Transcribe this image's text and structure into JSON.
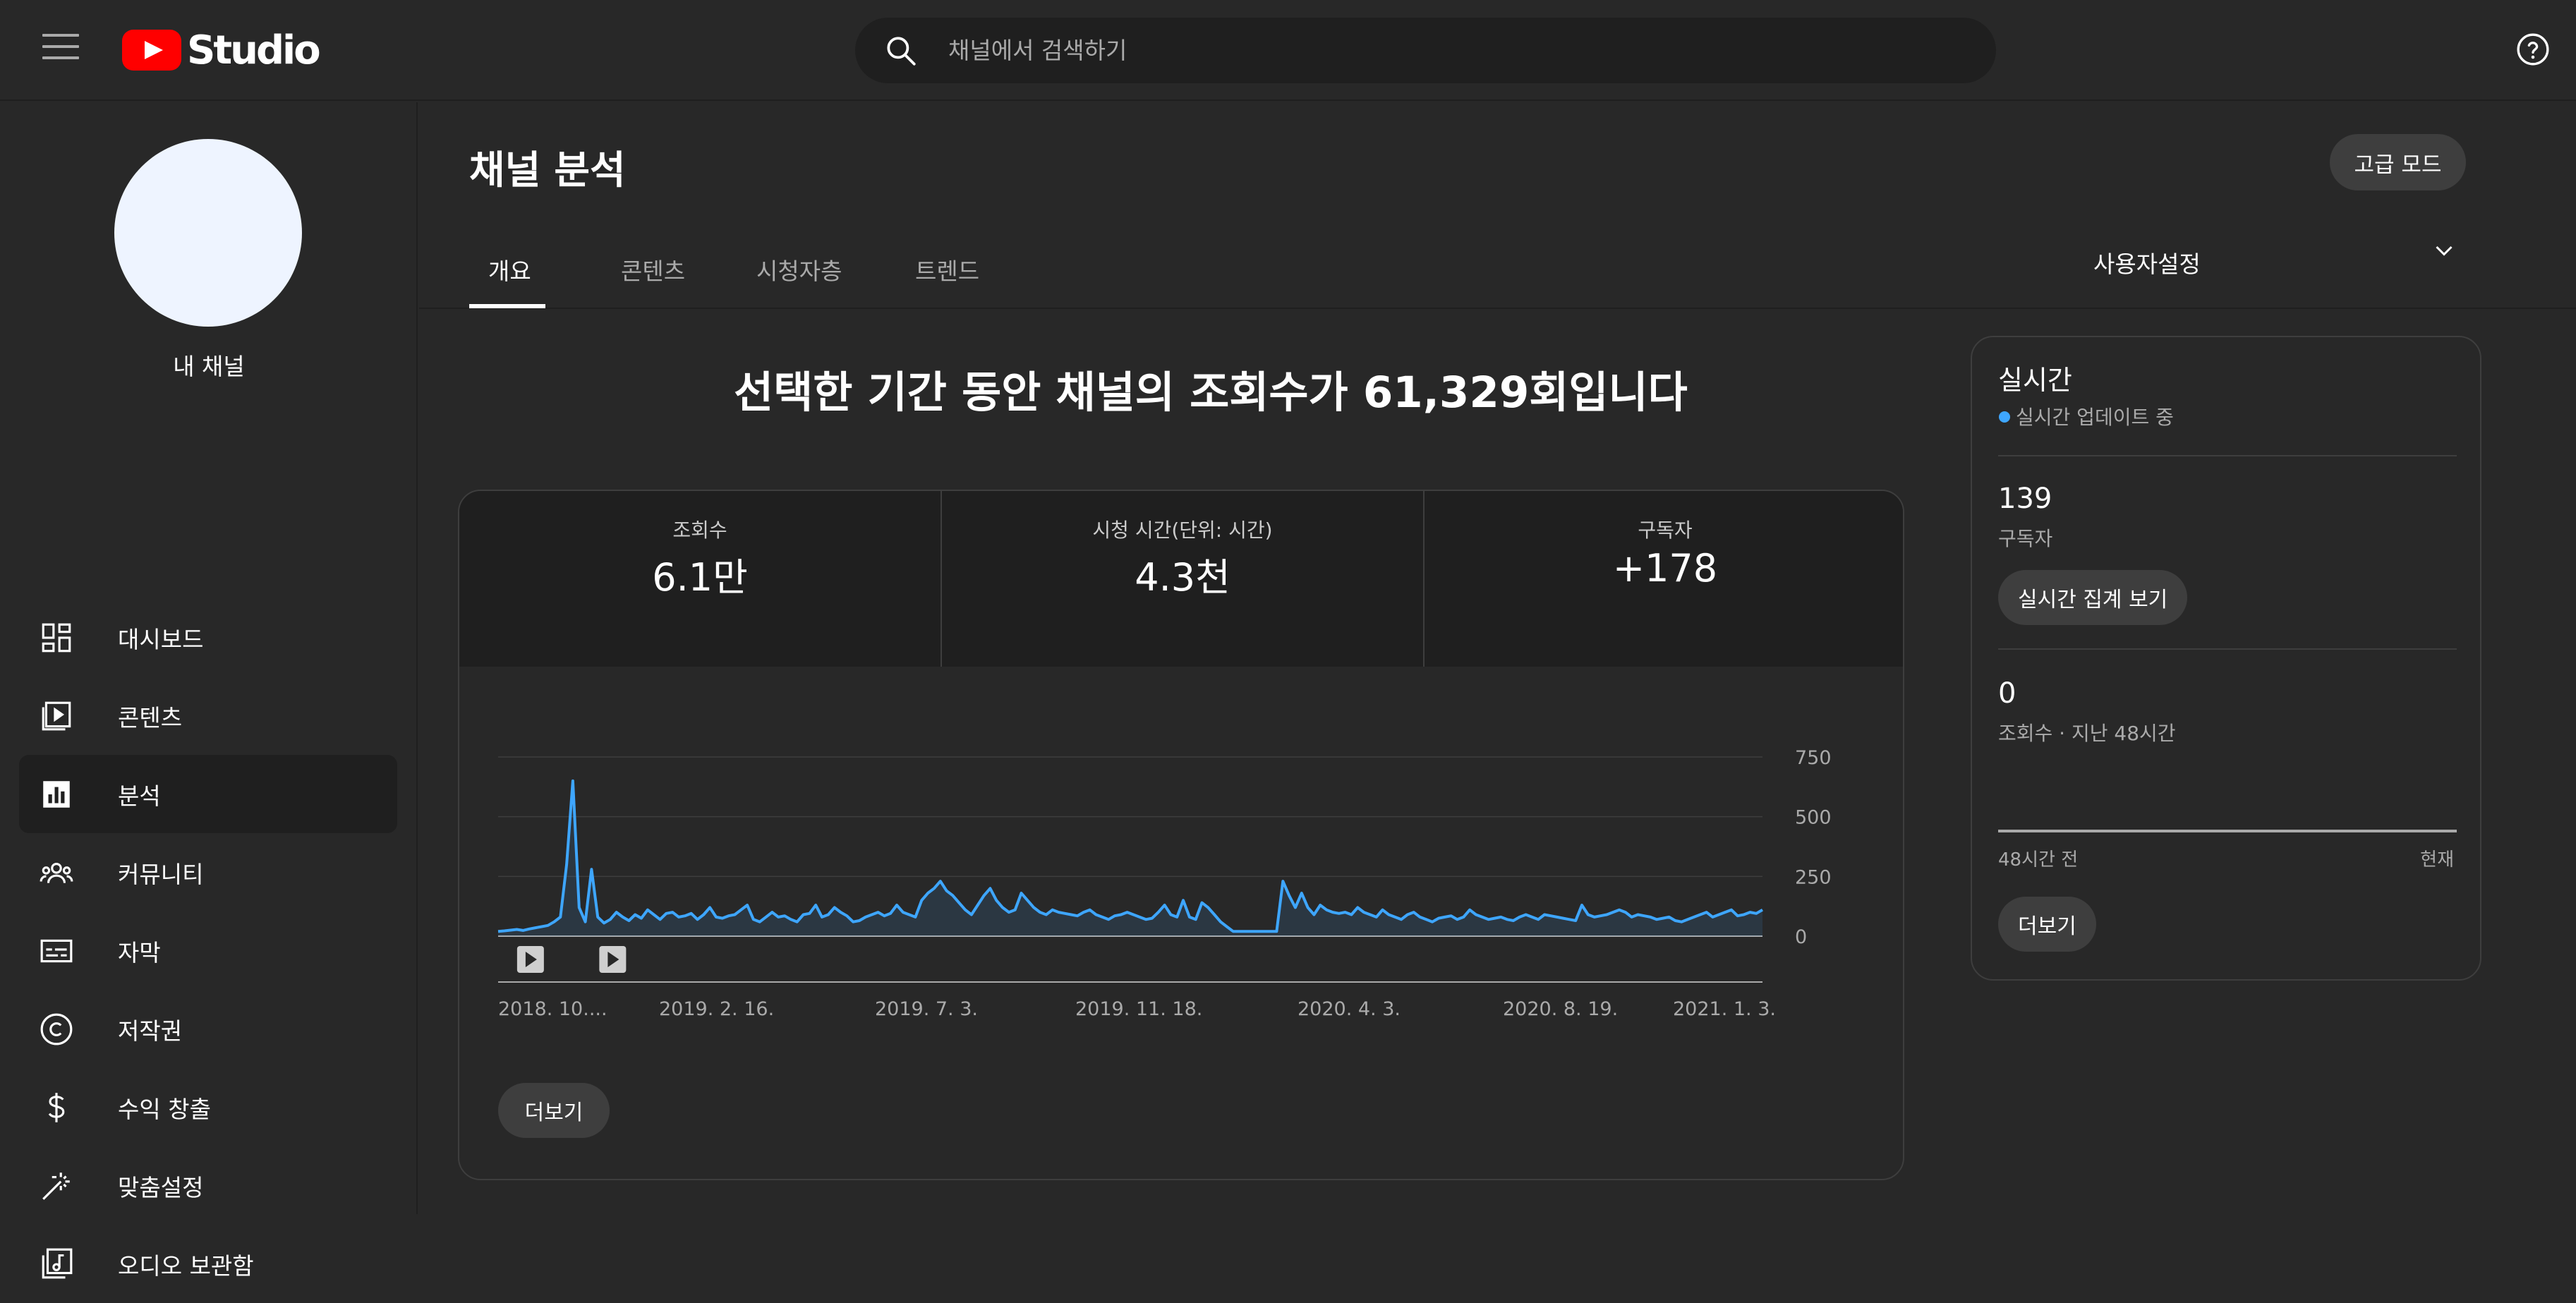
{
  "app": {
    "logo_text": "Studio",
    "brand_color": "#ff0000",
    "accent_color": "#3ea6ff"
  },
  "search": {
    "placeholder": "채널에서 검색하기"
  },
  "icons": {
    "menu": "hamburger-menu-icon",
    "search": "search-icon",
    "help": "help-icon",
    "dashboard": "dashboard-icon",
    "content": "content-icon",
    "analytics": "analytics-icon",
    "community": "community-icon",
    "subtitles": "subtitles-icon",
    "copyright": "copyright-icon",
    "monetization": "dollar-icon",
    "customization": "magic-wand-icon",
    "audio_library": "audio-library-icon",
    "chevron": "chevron-down-icon"
  },
  "sidebar": {
    "channel_name": "내 채널",
    "items": [
      {
        "label": "대시보드",
        "icon": "dashboard-icon",
        "active": false
      },
      {
        "label": "콘텐츠",
        "icon": "content-icon",
        "active": false
      },
      {
        "label": "분석",
        "icon": "analytics-icon",
        "active": true
      },
      {
        "label": "커뮤니티",
        "icon": "community-icon",
        "active": false
      },
      {
        "label": "자막",
        "icon": "subtitles-icon",
        "active": false
      },
      {
        "label": "저작권",
        "icon": "copyright-icon",
        "active": false
      },
      {
        "label": "수익 창출",
        "icon": "dollar-icon",
        "active": false
      },
      {
        "label": "맞춤설정",
        "icon": "magic-wand-icon",
        "active": false
      },
      {
        "label": "오디오 보관함",
        "icon": "audio-library-icon",
        "active": false
      }
    ]
  },
  "header": {
    "title": "채널 분석",
    "advanced_button": "고급 모드",
    "tabs": [
      {
        "label": "개요",
        "active": true
      },
      {
        "label": "콘텐츠",
        "active": false
      },
      {
        "label": "시청자층",
        "active": false
      },
      {
        "label": "트렌드",
        "active": false
      }
    ],
    "date_range": "사용자설정"
  },
  "overview": {
    "headline": "선택한 기간 동안 채널의 조회수가 61,329회입니다",
    "metrics": [
      {
        "label": "조회수",
        "value": "6.1만"
      },
      {
        "label": "시청 시간(단위: 시간)",
        "value": "4.3천"
      },
      {
        "label": "구독자",
        "value": "+178"
      }
    ],
    "more_button": "더보기"
  },
  "chart_data": {
    "type": "area",
    "series": [
      {
        "values": [
          20,
          22,
          25,
          28,
          24,
          30,
          35,
          40,
          45,
          60,
          80,
          300,
          650,
          120,
          60,
          280,
          80,
          55,
          70,
          100,
          80,
          65,
          90,
          75,
          110,
          90,
          70,
          95,
          100,
          80,
          85,
          95,
          70,
          90,
          120,
          80,
          75,
          85,
          90,
          110,
          130,
          70,
          60,
          80,
          100,
          80,
          85,
          70,
          60,
          90,
          95,
          130,
          80,
          90,
          120,
          100,
          85,
          60,
          65,
          80,
          90,
          100,
          85,
          95,
          130,
          100,
          90,
          80,
          150,
          180,
          200,
          230,
          190,
          170,
          140,
          110,
          90,
          130,
          170,
          200,
          150,
          120,
          100,
          110,
          180,
          150,
          120,
          100,
          90,
          110,
          100,
          95,
          90,
          85,
          100,
          110,
          90,
          80,
          70,
          85,
          90,
          100,
          90,
          80,
          70,
          75,
          100,
          130,
          90,
          80,
          150,
          80,
          70,
          140,
          120,
          90,
          60,
          40,
          20,
          20,
          20,
          20,
          20,
          20,
          20,
          20,
          230,
          170,
          120,
          180,
          120,
          90,
          130,
          110,
          100,
          95,
          100,
          90,
          120,
          100,
          90,
          80,
          110,
          90,
          80,
          70,
          90,
          100,
          80,
          70,
          60,
          75,
          80,
          85,
          70,
          80,
          110,
          90,
          80,
          70,
          75,
          80,
          70,
          65,
          80,
          90,
          80,
          70,
          90,
          85,
          80,
          75,
          70,
          65,
          130,
          90,
          80,
          85,
          90,
          100,
          110,
          100,
          80,
          90,
          85,
          80,
          70,
          75,
          80,
          65,
          60,
          70,
          80,
          90,
          100,
          80,
          90,
          100,
          110,
          85,
          90,
          100,
          95,
          110
        ]
      }
    ],
    "x_tick_labels": [
      "2018. 10....",
      "2019. 2. 16.",
      "2019. 7. 3.",
      "2019. 11. 18.",
      "2020. 4. 3.",
      "2020. 8. 19.",
      "2021. 1. 3."
    ],
    "y_ticks": [
      0,
      250,
      500,
      750
    ],
    "ylim": [
      0,
      750
    ],
    "grid": true,
    "line_color": "#3ea6ff",
    "video_markers": 2
  },
  "realtime": {
    "title": "실시간",
    "status": "실시간 업데이트 중",
    "subscribers": "139",
    "subscribers_label": "구독자",
    "live_count_button": "실시간 집계 보기",
    "views": "0",
    "views_label": "조회수 · 지난 48시간",
    "axis_start": "48시간 전",
    "axis_end": "현재",
    "more_button": "더보기"
  }
}
